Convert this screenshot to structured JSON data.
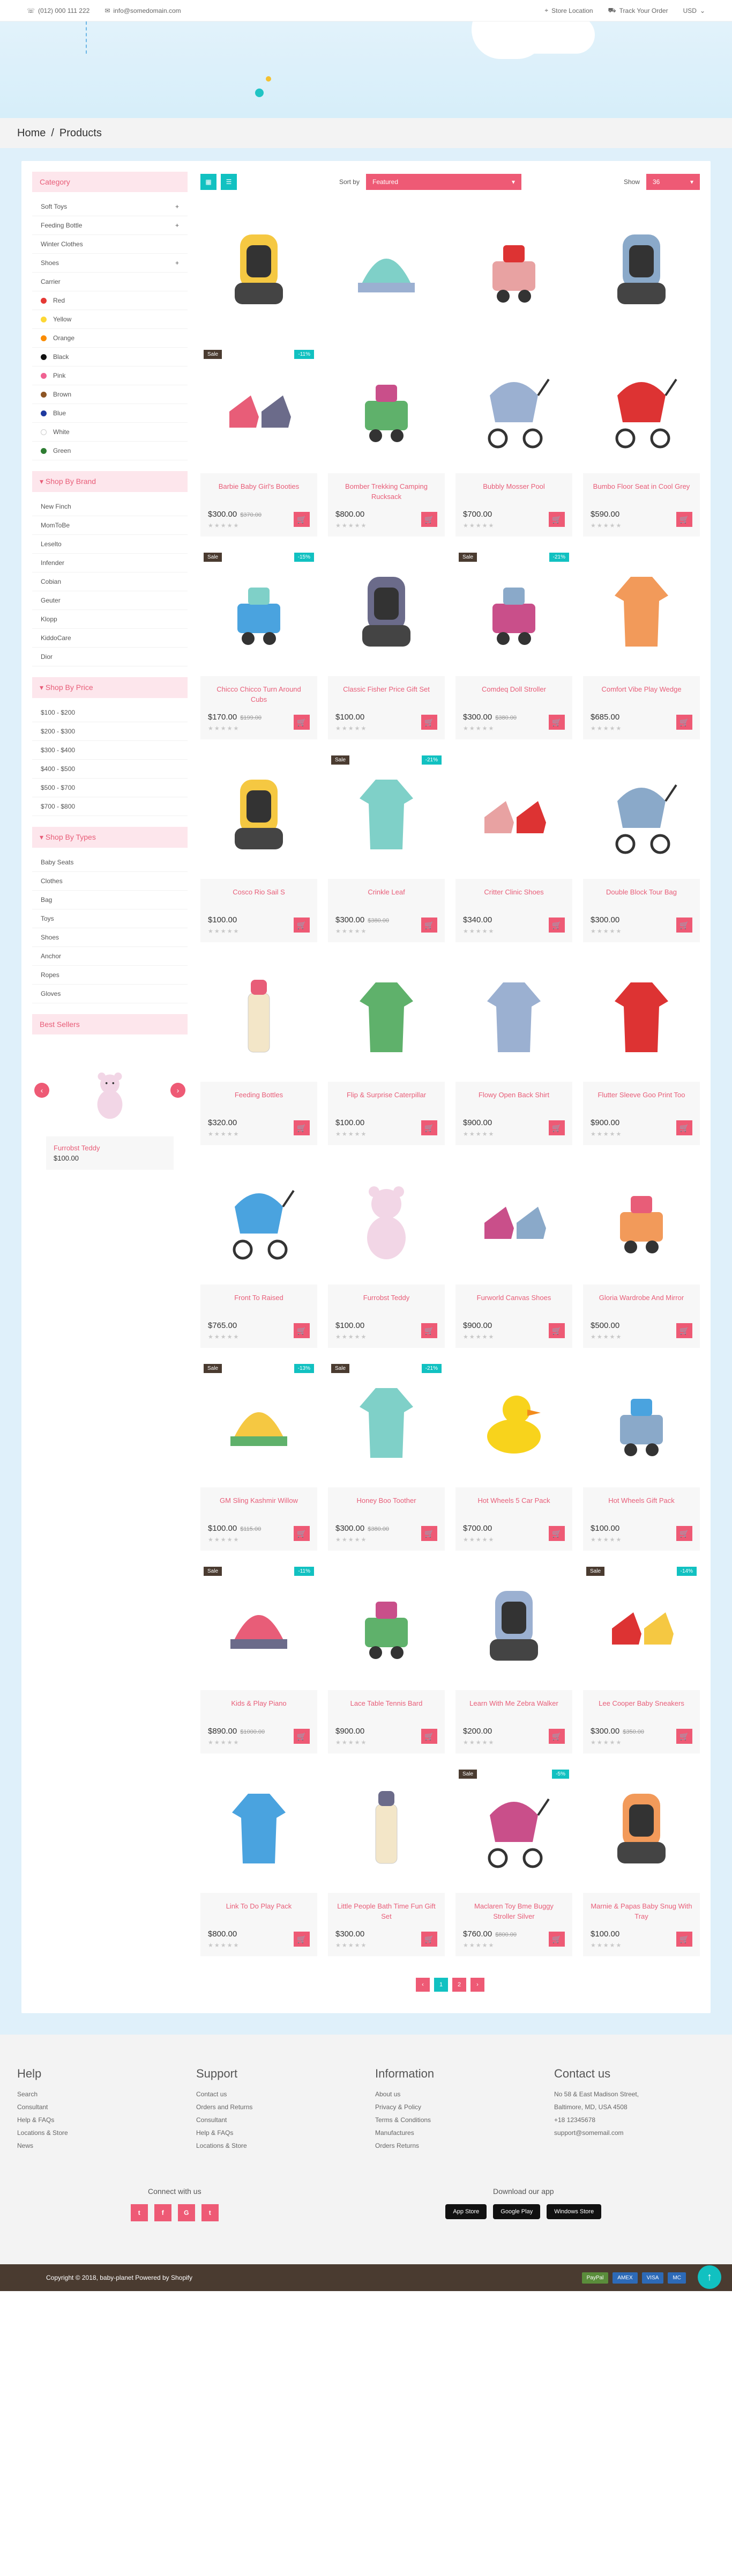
{
  "topbar": {
    "phone": "(012) 000 111 222",
    "email": "info@somedomain.com",
    "store_location": "Store Location",
    "track_order": "Track Your Order",
    "currency": "USD"
  },
  "breadcrumb": {
    "home": "Home",
    "separator": "/",
    "current": "Products"
  },
  "sidebar": {
    "category_title": "Category",
    "categories": [
      "Soft Toys",
      "Feeding Bottle",
      "Winter Clothes",
      "Shoes",
      "Carrier"
    ],
    "colors": [
      {
        "name": "Red",
        "hex": "#e53935"
      },
      {
        "name": "Yellow",
        "hex": "#fdd835"
      },
      {
        "name": "Orange",
        "hex": "#fb8c00"
      },
      {
        "name": "Black",
        "hex": "#111111"
      },
      {
        "name": "Pink",
        "hex": "#f06292"
      },
      {
        "name": "Brown",
        "hex": "#8d5524"
      },
      {
        "name": "Blue",
        "hex": "#1e3a9f"
      },
      {
        "name": "White",
        "hex": "#ffffff"
      },
      {
        "name": "Green",
        "hex": "#2e7d32"
      }
    ],
    "brand_title": "Shop By Brand",
    "brands": [
      "New Finch",
      "MomToBe",
      "Leselto",
      "Infender",
      "Cobian",
      "Geuter",
      "Klopp",
      "KiddoCare",
      "Dior"
    ],
    "price_title": "Shop By Price",
    "prices": [
      "$100 - $200",
      "$200 - $300",
      "$300 - $400",
      "$400 - $500",
      "$500 - $700",
      "$700 - $800"
    ],
    "types_title": "Shop By Types",
    "types": [
      "Baby Seats",
      "Clothes",
      "Bag",
      "Toys",
      "Shoes",
      "Anchor",
      "Ropes",
      "Gloves"
    ],
    "bestsellers_title": "Best Sellers",
    "bestseller": {
      "name": "Furrobst Teddy",
      "price": "$100.00"
    }
  },
  "toolbar": {
    "sort_label": "Sort by",
    "sort_value": "Featured",
    "show_label": "Show",
    "show_value": "36"
  },
  "products": [
    {
      "name": "",
      "price": "",
      "old": "",
      "sale": "",
      "off": ""
    },
    {
      "name": "",
      "price": "",
      "old": "",
      "sale": "",
      "off": ""
    },
    {
      "name": "",
      "price": "",
      "old": "",
      "sale": "",
      "off": ""
    },
    {
      "name": "",
      "price": "",
      "old": "",
      "sale": "",
      "off": ""
    },
    {
      "name": "Barbie Baby Girl's Booties",
      "price": "$300.00",
      "old": "$370.00",
      "sale": "Sale",
      "off": "-11%"
    },
    {
      "name": "Bomber Trekking Camping Rucksack",
      "price": "$800.00",
      "old": "",
      "sale": "",
      "off": ""
    },
    {
      "name": "Bubbly Mosser Pool",
      "price": "$700.00",
      "old": "",
      "sale": "",
      "off": ""
    },
    {
      "name": "Bumbo Floor Seat in Cool Grey",
      "price": "$590.00",
      "old": "",
      "sale": "",
      "off": ""
    },
    {
      "name": "Chicco Chicco Turn Around Cubs",
      "price": "$170.00",
      "old": "$199.00",
      "sale": "Sale",
      "off": "-15%"
    },
    {
      "name": "Classic Fisher Price Gift Set",
      "price": "$100.00",
      "old": "",
      "sale": "",
      "off": ""
    },
    {
      "name": "Comdeq Doll Stroller",
      "price": "$300.00",
      "old": "$380.00",
      "sale": "Sale",
      "off": "-21%"
    },
    {
      "name": "Comfort Vibe Play Wedge",
      "price": "$685.00",
      "old": "",
      "sale": "",
      "off": ""
    },
    {
      "name": "Cosco Rio Sail S",
      "price": "$100.00",
      "old": "",
      "sale": "",
      "off": ""
    },
    {
      "name": "Crinkle Leaf",
      "price": "$300.00",
      "old": "$380.00",
      "sale": "Sale",
      "off": "-21%"
    },
    {
      "name": "Critter Clinic Shoes",
      "price": "$340.00",
      "old": "",
      "sale": "",
      "off": ""
    },
    {
      "name": "Double Block Tour Bag",
      "price": "$300.00",
      "old": "",
      "sale": "",
      "off": ""
    },
    {
      "name": "Feeding Bottles",
      "price": "$320.00",
      "old": "",
      "sale": "",
      "off": ""
    },
    {
      "name": "Flip & Surprise Caterpillar",
      "price": "$100.00",
      "old": "",
      "sale": "",
      "off": ""
    },
    {
      "name": "Flowy Open Back Shirt",
      "price": "$900.00",
      "old": "",
      "sale": "",
      "off": ""
    },
    {
      "name": "Flutter Sleeve Goo Print Too",
      "price": "$900.00",
      "old": "",
      "sale": "",
      "off": ""
    },
    {
      "name": "Front To Raised",
      "price": "$765.00",
      "old": "",
      "sale": "",
      "off": ""
    },
    {
      "name": "Furrobst Teddy",
      "price": "$100.00",
      "old": "",
      "sale": "",
      "off": ""
    },
    {
      "name": "Furworld Canvas Shoes",
      "price": "$900.00",
      "old": "",
      "sale": "",
      "off": ""
    },
    {
      "name": "Gloria Wardrobe And Mirror",
      "price": "$500.00",
      "old": "",
      "sale": "",
      "off": ""
    },
    {
      "name": "GM Sling Kashmir Willow",
      "price": "$100.00",
      "old": "$115.00",
      "sale": "Sale",
      "off": "-13%"
    },
    {
      "name": "Honey Boo Toother",
      "price": "$300.00",
      "old": "$380.00",
      "sale": "Sale",
      "off": "-21%"
    },
    {
      "name": "Hot Wheels 5 Car Pack",
      "price": "$700.00",
      "old": "",
      "sale": "",
      "off": ""
    },
    {
      "name": "Hot Wheels Gift Pack",
      "price": "$100.00",
      "old": "",
      "sale": "",
      "off": ""
    },
    {
      "name": "Kids & Play Piano",
      "price": "$890.00",
      "old": "$1000.00",
      "sale": "Sale",
      "off": "-11%"
    },
    {
      "name": "Lace Table Tennis Bard",
      "price": "$900.00",
      "old": "",
      "sale": "",
      "off": ""
    },
    {
      "name": "Learn With Me Zebra Walker",
      "price": "$200.00",
      "old": "",
      "sale": "",
      "off": ""
    },
    {
      "name": "Lee Cooper Baby Sneakers",
      "price": "$300.00",
      "old": "$350.00",
      "sale": "Sale",
      "off": "-14%"
    },
    {
      "name": "Link To Do Play Pack",
      "price": "$800.00",
      "old": "",
      "sale": "",
      "off": ""
    },
    {
      "name": "Little People Bath Time Fun Gift Set",
      "price": "$300.00",
      "old": "",
      "sale": "",
      "off": ""
    },
    {
      "name": "Maclaren Toy Bme Buggy Stroller Silver",
      "price": "$760.00",
      "old": "$800.00",
      "sale": "Sale",
      "off": "-5%"
    },
    {
      "name": "Marnie & Papas Baby Snug With Tray",
      "price": "$100.00",
      "old": "",
      "sale": "",
      "off": ""
    }
  ],
  "product_icons": [
    "car-seat-icon",
    "baby-hat-icon",
    "pacifier-icon",
    "carrier-icon",
    "booties-icon",
    "toy-truck-icon",
    "stroller-icon",
    "pram-icon",
    "stacking-cups-icon",
    "car-seat-icon",
    "toy-turtle-icon",
    "romper-icon",
    "car-seat-icon",
    "onesie-icon",
    "baby-socks-icon",
    "stroller-icon",
    "feeding-bottle-icon",
    "snowsuit-icon",
    "dress-icon",
    "dress-icon",
    "stroller-icon",
    "teddy-icon",
    "shoes-icon",
    "bead-maze-icon",
    "panda-hat-icon",
    "raincoat-icon",
    "duck-icon",
    "bib-icon",
    "knit-hat-icon",
    "pacifier-icon",
    "car-seat-icon",
    "sneakers-icon",
    "bodysuit-icon",
    "feeding-bottle-icon",
    "pram-icon",
    "car-seat-icon"
  ],
  "pagination": [
    "‹",
    "1",
    "2",
    "›"
  ],
  "footer": {
    "help_title": "Help",
    "help": [
      "Search",
      "Consultant",
      "Help & FAQs",
      "Locations & Store",
      "News"
    ],
    "support_title": "Support",
    "support": [
      "Contact us",
      "Orders and Returns",
      "Consultant",
      "Help & FAQs",
      "Locations & Store"
    ],
    "info_title": "Information",
    "info": [
      "About us",
      "Privacy & Policy",
      "Terms & Conditions",
      "Manufactures",
      "Orders Returns"
    ],
    "contact_title": "Contact us",
    "contact": [
      "No 58 & East Madison Street,",
      "Baltimore, MD, USA 4508",
      "+18 12345678",
      "support@somemail.com"
    ],
    "connect_title": "Connect with us",
    "socials": [
      "t",
      "f",
      "G",
      "t"
    ],
    "download_title": "Download our app",
    "stores": [
      "App Store",
      "Google Play",
      "Windows Store"
    ],
    "copyright": "Copyright © 2018, baby-planet Powered by Shopify",
    "payments": [
      "PayPal",
      "AMEX",
      "VISA",
      "MC"
    ]
  }
}
